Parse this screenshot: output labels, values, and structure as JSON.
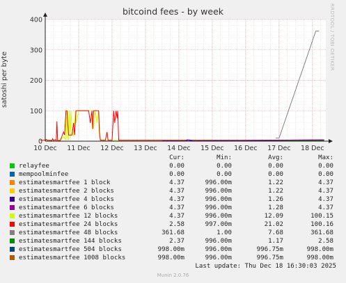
{
  "title": "bitcoind fees - by week",
  "watermark": "RRDTOOL / TOBI OETIKER",
  "legend_headers": {
    "cur": "Cur:",
    "min": "Min:",
    "avg": "Avg:",
    "max": "Max:"
  },
  "legend": [
    {
      "name": "relayfee",
      "color": "#00cc00",
      "cur": "0.00",
      "min": "0.00",
      "avg": "0.00",
      "max": "0.00"
    },
    {
      "name": "mempoolminfee",
      "color": "#0066b3",
      "cur": "0.00",
      "min": "0.00",
      "avg": "0.00",
      "max": "0.00"
    },
    {
      "name": "estimatesmartfee 1 block",
      "color": "#ff8000",
      "cur": "4.37",
      "min": "996.00m",
      "avg": "1.22",
      "max": "4.37"
    },
    {
      "name": "estimatesmartfee 2 blocks",
      "color": "#ffcc00",
      "cur": "4.37",
      "min": "996.00m",
      "avg": "1.22",
      "max": "4.37"
    },
    {
      "name": "estimatesmartfee 4 blocks",
      "color": "#330099",
      "cur": "4.37",
      "min": "996.00m",
      "avg": "1.26",
      "max": "4.37"
    },
    {
      "name": "estimatesmartfee 6 blocks",
      "color": "#990099",
      "cur": "4.37",
      "min": "996.00m",
      "avg": "1.28",
      "max": "4.37"
    },
    {
      "name": "estimatesmartfee 12 blocks",
      "color": "#ccff00",
      "cur": "4.37",
      "min": "996.00m",
      "avg": "12.09",
      "max": "100.15"
    },
    {
      "name": "estimatesmartfee 24 blocks",
      "color": "#ff0000",
      "cur": "2.58",
      "min": "997.00m",
      "avg": "21.02",
      "max": "100.16"
    },
    {
      "name": "estimatesmartfee 48 blocks",
      "color": "#808080",
      "cur": "361.68",
      "min": "1.00",
      "avg": "7.68",
      "max": "361.68"
    },
    {
      "name": "estimatesmartfee 144 blocks",
      "color": "#008f00",
      "cur": "2.37",
      "min": "996.00m",
      "avg": "1.17",
      "max": "2.58"
    },
    {
      "name": "estimatesmartfee 504 blocks",
      "color": "#00487d",
      "cur": "998.00m",
      "min": "996.00m",
      "avg": "996.75m",
      "max": "998.00m"
    },
    {
      "name": "estimatesmartfee 1008 blocks",
      "color": "#b35a00",
      "cur": "998.00m",
      "min": "996.00m",
      "avg": "996.75m",
      "max": "998.00m"
    }
  ],
  "last_update": "Last update: Thu Dec 18 16:30:03 2025",
  "munin_version": "Munin 2.0.76",
  "chart_data": {
    "type": "line",
    "title": "bitcoind fees - by week",
    "ylabel": "satoshi per byte",
    "xlabel": "",
    "ylim": [
      0,
      400
    ],
    "yticks": [
      0,
      100,
      200,
      300,
      400
    ],
    "xlim": [
      10,
      18.4
    ],
    "xticks": [
      {
        "x": 10,
        "label": "10 Dec"
      },
      {
        "x": 11,
        "label": "11 Dec"
      },
      {
        "x": 12,
        "label": "12 Dec"
      },
      {
        "x": 13,
        "label": "13 Dec"
      },
      {
        "x": 14,
        "label": "14 Dec"
      },
      {
        "x": 15,
        "label": "15 Dec"
      },
      {
        "x": 16,
        "label": "16 Dec"
      },
      {
        "x": 17,
        "label": "17 Dec"
      },
      {
        "x": 18,
        "label": "18 Dec"
      }
    ],
    "grid": true,
    "series": [
      {
        "name": "estimatesmartfee 12 blocks",
        "color": "#ccff00",
        "points": [
          [
            10.0,
            3
          ],
          [
            10.45,
            3
          ],
          [
            10.55,
            15
          ],
          [
            10.6,
            5
          ],
          [
            10.63,
            80
          ],
          [
            10.65,
            3
          ],
          [
            10.67,
            100
          ],
          [
            10.7,
            4
          ],
          [
            10.72,
            100
          ],
          [
            10.75,
            10
          ],
          [
            10.77,
            100
          ],
          [
            10.8,
            40
          ],
          [
            10.85,
            15
          ],
          [
            10.9,
            100
          ],
          [
            10.93,
            60
          ],
          [
            11.0,
            100
          ],
          [
            11.4,
            100
          ],
          [
            11.45,
            40
          ],
          [
            11.5,
            100
          ],
          [
            11.55,
            60
          ],
          [
            11.6,
            100
          ],
          [
            11.65,
            5
          ],
          [
            11.7,
            3
          ],
          [
            12.0,
            3
          ],
          [
            12.4,
            3
          ],
          [
            18.35,
            4
          ]
        ]
      },
      {
        "name": "estimatesmartfee 24 blocks",
        "color": "#ff0000",
        "points": [
          [
            9.85,
            3
          ],
          [
            10.0,
            3
          ],
          [
            10.03,
            6
          ],
          [
            10.06,
            3
          ],
          [
            10.2,
            2
          ],
          [
            10.22,
            8
          ],
          [
            10.25,
            2
          ],
          [
            10.3,
            5
          ],
          [
            10.33,
            2
          ],
          [
            10.35,
            65
          ],
          [
            10.37,
            2
          ],
          [
            10.45,
            2
          ],
          [
            10.55,
            30
          ],
          [
            10.58,
            20
          ],
          [
            10.62,
            100
          ],
          [
            10.65,
            100
          ],
          [
            10.7,
            20
          ],
          [
            10.8,
            20
          ],
          [
            10.85,
            60
          ],
          [
            10.88,
            20
          ],
          [
            10.92,
            100
          ],
          [
            11.3,
            100
          ],
          [
            11.35,
            60
          ],
          [
            11.4,
            100
          ],
          [
            11.42,
            40
          ],
          [
            11.45,
            100
          ],
          [
            11.6,
            100
          ],
          [
            11.62,
            30
          ],
          [
            11.65,
            3
          ],
          [
            11.8,
            3
          ],
          [
            11.85,
            30
          ],
          [
            11.88,
            3
          ],
          [
            12.0,
            3
          ],
          [
            12.05,
            100
          ],
          [
            12.08,
            60
          ],
          [
            12.12,
            100
          ],
          [
            12.15,
            75
          ],
          [
            12.17,
            100
          ],
          [
            12.2,
            3
          ],
          [
            12.4,
            3
          ],
          [
            13.2,
            3
          ],
          [
            14.0,
            3
          ],
          [
            15.0,
            3
          ],
          [
            16.0,
            3
          ],
          [
            17.0,
            3
          ],
          [
            18.0,
            3
          ],
          [
            18.35,
            2.58
          ]
        ]
      },
      {
        "name": "estimatesmartfee 48 blocks",
        "color": "#808080",
        "points": [
          [
            16.9,
            10
          ],
          [
            17.0,
            10
          ],
          [
            18.1,
            361.68
          ],
          [
            18.2,
            361.68
          ]
        ]
      },
      {
        "name": "estimatesmartfee 144 blocks",
        "color": "#008f00",
        "points": [
          [
            15.7,
            2
          ],
          [
            16.4,
            2
          ],
          [
            17.4,
            2
          ],
          [
            18.35,
            2.37
          ]
        ]
      },
      {
        "name": "estimatesmartfee 4 blocks",
        "color": "#330099",
        "points": [
          [
            13.5,
            1
          ],
          [
            14.2,
            1
          ],
          [
            14.25,
            4.37
          ],
          [
            14.4,
            1
          ],
          [
            18.35,
            4.37
          ]
        ]
      },
      {
        "name": "estimatesmartfee 6 blocks",
        "color": "#990099",
        "points": [
          [
            13.5,
            1
          ],
          [
            14.2,
            1
          ],
          [
            14.3,
            4.37
          ],
          [
            14.5,
            1
          ],
          [
            18.35,
            4.37
          ]
        ]
      }
    ]
  }
}
